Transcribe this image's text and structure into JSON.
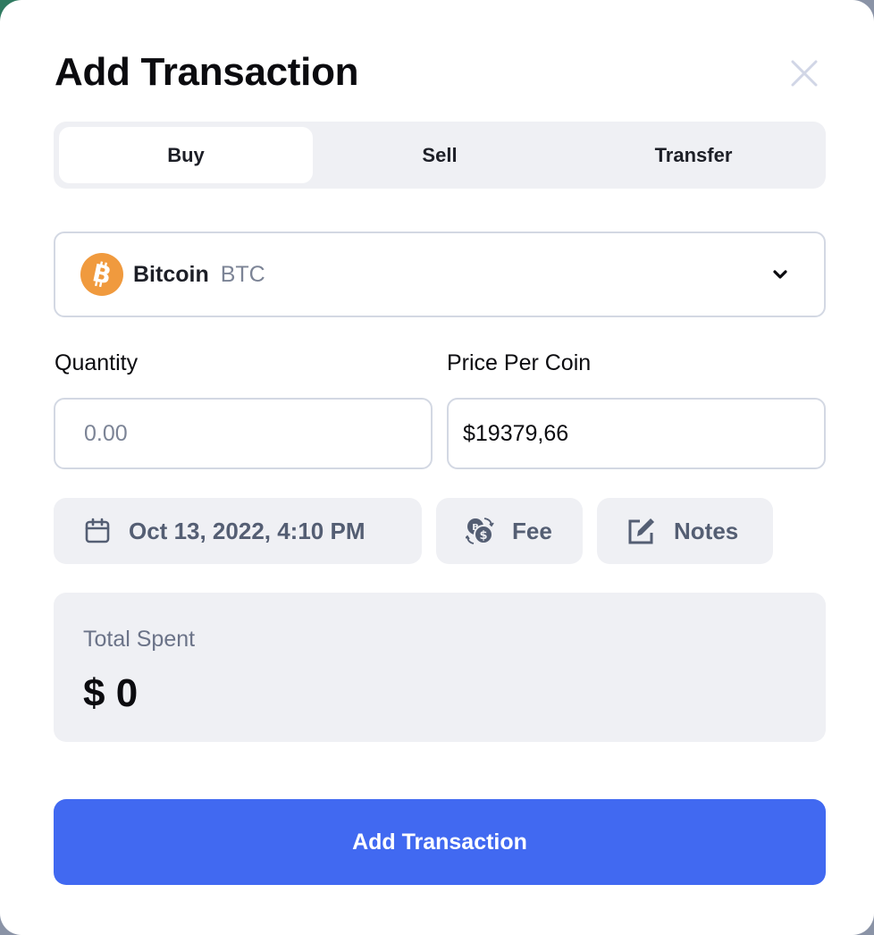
{
  "modal": {
    "title": "Add Transaction",
    "close_icon": "close-icon"
  },
  "tabs": [
    {
      "label": "Buy",
      "active": true
    },
    {
      "label": "Sell",
      "active": false
    },
    {
      "label": "Transfer",
      "active": false
    }
  ],
  "coin": {
    "name": "Bitcoin",
    "symbol": "BTC",
    "icon": "bitcoin-icon",
    "icon_color": "#f09a3e",
    "dropdown_icon": "chevron-down-icon"
  },
  "quantity": {
    "label": "Quantity",
    "value": "",
    "placeholder": "0.00"
  },
  "price": {
    "label": "Price Per Coin",
    "value": "$19379,66"
  },
  "actions": {
    "date": {
      "label": "Oct 13, 2022, 4:10 PM",
      "icon": "calendar-icon"
    },
    "fee": {
      "label": "Fee",
      "icon": "currency-exchange-icon"
    },
    "notes": {
      "label": "Notes",
      "icon": "edit-note-icon"
    }
  },
  "summary": {
    "label": "Total Spent",
    "value": "$ 0"
  },
  "submit": {
    "label": "Add Transaction",
    "color": "#4169f1"
  }
}
